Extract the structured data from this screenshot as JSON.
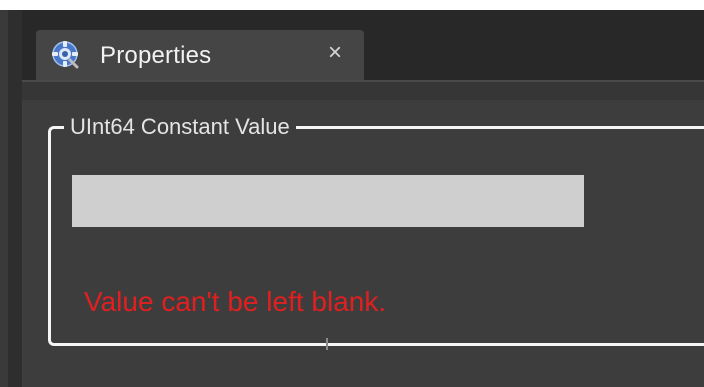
{
  "tab": {
    "title": "Properties",
    "close_glyph": "×",
    "icon": "properties-gear-icon"
  },
  "group": {
    "legend": "UInt64 Constant Value"
  },
  "value_field": {
    "value": "",
    "placeholder": ""
  },
  "validation": {
    "error": "Value can't be left blank.",
    "error_color": "#e02020"
  },
  "colors": {
    "panel": "#3d3d3d",
    "tab": "#454545",
    "input": "#cfcfcf",
    "border": "#f5f5f5"
  }
}
